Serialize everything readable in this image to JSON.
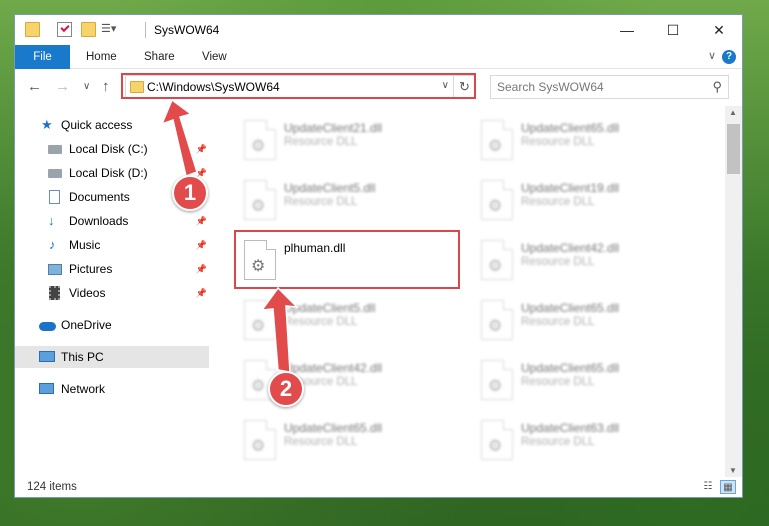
{
  "window": {
    "title": "SysWOW64",
    "minimize_glyph": "—",
    "maximize_glyph": "☐",
    "close_glyph": "✕"
  },
  "ribbon": {
    "tabs": [
      "File",
      "Home",
      "Share",
      "View"
    ],
    "help_glyph": "?",
    "collapse_glyph": "∨"
  },
  "nav": {
    "back_glyph": "←",
    "forward_glyph": "→",
    "recent_glyph": "∨",
    "up_glyph": "↑",
    "address": "C:\\Windows\\SysWOW64",
    "dropdown_glyph": "∨",
    "refresh_glyph": "↻",
    "search_placeholder": "Search SysWOW64",
    "search_glyph": "⚲"
  },
  "sidebar": {
    "items": [
      {
        "label": "Quick access",
        "icon": "star-icon",
        "pinned": false
      },
      {
        "label": "Local Disk (C:)",
        "icon": "drive-icon",
        "pinned": true
      },
      {
        "label": "Local Disk (D:)",
        "icon": "drive-icon",
        "pinned": true
      },
      {
        "label": "Documents",
        "icon": "document-icon",
        "pinned": true
      },
      {
        "label": "Downloads",
        "icon": "download-icon",
        "pinned": true
      },
      {
        "label": "Music",
        "icon": "music-icon",
        "pinned": true
      },
      {
        "label": "Pictures",
        "icon": "pictures-icon",
        "pinned": true
      },
      {
        "label": "Videos",
        "icon": "video-icon",
        "pinned": true
      },
      {
        "label": "OneDrive",
        "icon": "cloud-icon",
        "pinned": false
      },
      {
        "label": "This PC",
        "icon": "computer-icon",
        "pinned": false,
        "selected": true
      },
      {
        "label": "Network",
        "icon": "network-icon",
        "pinned": false
      }
    ],
    "pin_glyph": "📌"
  },
  "files": [
    {
      "name": "UpdateClient21.dll",
      "desc": "Resource DLL",
      "blurred": true
    },
    {
      "name": "UpdateClient65.dll",
      "desc": "Resource DLL",
      "blurred": true
    },
    {
      "name": "UpdateClient5.dll",
      "desc": "Resource DLL",
      "blurred": true
    },
    {
      "name": "UpdateClient19.dll",
      "desc": "Resource DLL",
      "blurred": true
    },
    {
      "name": "plhuman.dll",
      "desc": "",
      "blurred": false
    },
    {
      "name": "UpdateClient42.dll",
      "desc": "Resource DLL",
      "blurred": true
    },
    {
      "name": "UpdateClient5.dll",
      "desc": "Resource DLL",
      "blurred": true
    },
    {
      "name": "UpdateClient65.dll",
      "desc": "Resource DLL",
      "blurred": true
    },
    {
      "name": "UpdateClient42.dll",
      "desc": "Resource DLL",
      "blurred": true
    },
    {
      "name": "UpdateClient65.dll",
      "desc": "Resource DLL",
      "blurred": true
    },
    {
      "name": "UpdateClient65.dll",
      "desc": "Resource DLL",
      "blurred": true
    },
    {
      "name": "UpdateClient63.dll",
      "desc": "Resource DLL",
      "blurred": true
    }
  ],
  "status": {
    "item_count": "124 items"
  },
  "annotations": {
    "step1": "1",
    "step2": "2",
    "color": "#e24b4b"
  }
}
